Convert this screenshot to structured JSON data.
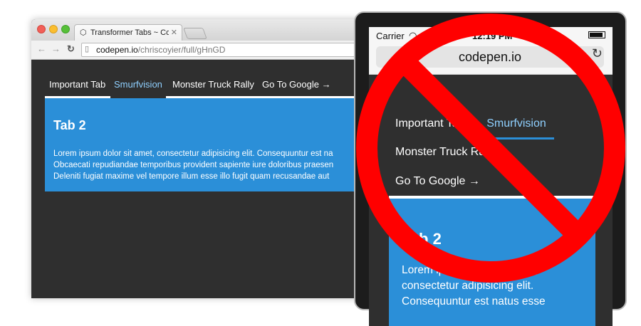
{
  "desktop": {
    "tab_title": "Transformer Tabs ~ CodeP",
    "tab_close": "✕",
    "url_host": "codepen.io",
    "url_path": "/chriscoyier/full/gHnGD",
    "nav": {
      "back": "←",
      "forward": "→",
      "reload": "C"
    },
    "tabs": [
      "Important Tab",
      "Smurfvision",
      "Monster Truck Rally",
      "Go To Google →"
    ],
    "active_tab_index": 1,
    "panel_title": "Tab 2",
    "panel_lines": [
      "Lorem ipsum dolor sit amet, consectetur adipisicing elit. Consequuntur est na",
      "Obcaecati repudiandae temporibus provident sapiente iure doloribus praesen",
      "Deleniti fugiat maxime vel tempore illum esse illo fugit quam recusandae aut"
    ]
  },
  "phone": {
    "carrier": "Carrier",
    "time": "12:19 PM",
    "url": "codepen.io",
    "tabs": [
      "Important Tab",
      "Smurfvision",
      "Monster Truck Rally",
      "Go To Google →"
    ],
    "active_tab_index": 1,
    "panel_title": "Tab 2",
    "panel_lines": [
      "Lorem ipsum dolor sit amet,",
      "consectetur adipisicing elit.",
      "Consequuntur est natus esse"
    ]
  },
  "colors": {
    "dark_bg": "#2f2f2f",
    "panel_blue": "#2b8fd8",
    "active_tab": "#8fd0ff",
    "sign_red": "#ff0000"
  },
  "icons": {
    "prohibition": "no-symbol-icon"
  }
}
